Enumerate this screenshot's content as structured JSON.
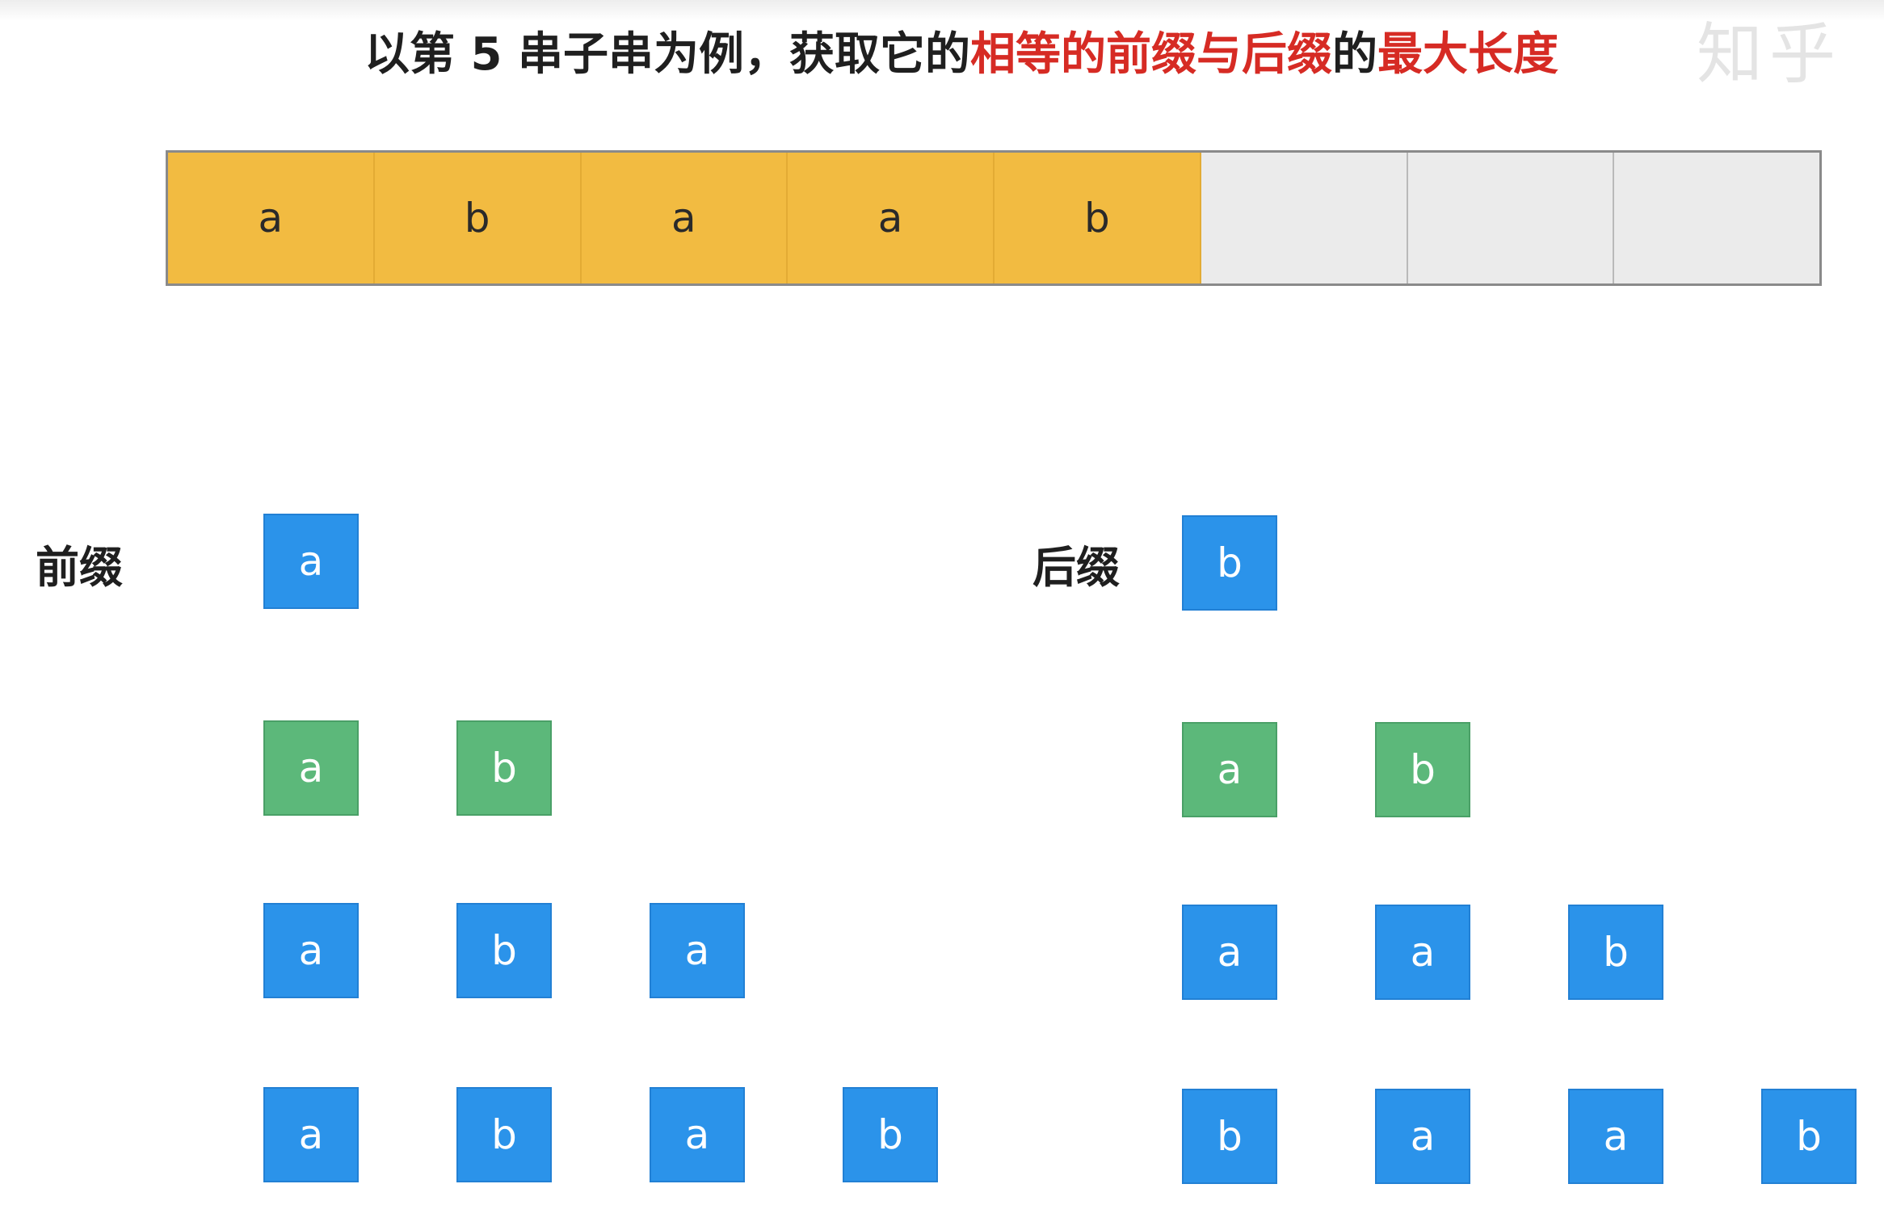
{
  "title": {
    "part1": "以第 5 串子串为例，获取它的",
    "highlight1": "相等的前缀与后缀",
    "part2": "的",
    "highlight2": "最大长度"
  },
  "watermark": "知乎",
  "substring": {
    "characters": [
      "a",
      "b",
      "a",
      "a",
      "b",
      "",
      "",
      ""
    ],
    "filled_count": 5
  },
  "prefix": {
    "label": "前缀",
    "rows": [
      {
        "chars": [
          "a"
        ],
        "highlight": false
      },
      {
        "chars": [
          "a",
          "b"
        ],
        "highlight": true
      },
      {
        "chars": [
          "a",
          "b",
          "a"
        ],
        "highlight": false
      },
      {
        "chars": [
          "a",
          "b",
          "a",
          "b"
        ],
        "highlight": false
      }
    ]
  },
  "suffix": {
    "label": "后缀",
    "rows": [
      {
        "chars": [
          "b"
        ],
        "highlight": false
      },
      {
        "chars": [
          "a",
          "b"
        ],
        "highlight": true
      },
      {
        "chars": [
          "a",
          "a",
          "b"
        ],
        "highlight": false
      },
      {
        "chars": [
          "b",
          "a",
          "a",
          "b"
        ],
        "highlight": false
      }
    ]
  },
  "colors": {
    "filled_cell": "#f2bb41",
    "empty_cell": "#ebebeb",
    "box_default": "#2b93ea",
    "box_match": "#5cb87a",
    "highlight_text": "#d62b24"
  }
}
